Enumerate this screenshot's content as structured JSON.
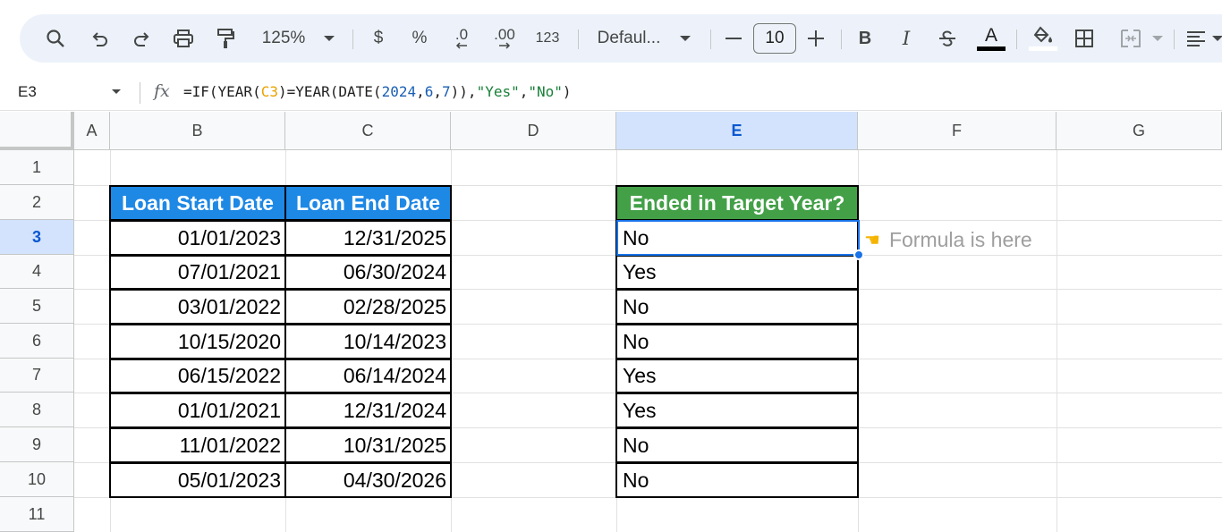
{
  "toolbar": {
    "zoom": "125%",
    "currency": "$",
    "percent": "%",
    "decrease_decimals": ".0",
    "increase_decimals": ".00",
    "number_format": "123",
    "font_family": "Defaul...",
    "font_size": "10",
    "bold": "B",
    "italic": "I",
    "text_color": "A"
  },
  "formula_bar": {
    "name_box": "E3",
    "fx": "fx",
    "formula_parts": {
      "p1": "=IF(YEAR(",
      "ref": "C3",
      "p2": ")=YEAR(DATE(",
      "n1": "2024",
      "c1": ",",
      "n2": "6",
      "c2": ",",
      "n3": "7",
      "p3": ")),",
      "s1": "\"Yes\"",
      "c3": ",",
      "s2": "\"No\"",
      "p4": ")"
    }
  },
  "columns": [
    "A",
    "B",
    "C",
    "D",
    "E",
    "F",
    "G"
  ],
  "rows": [
    "1",
    "2",
    "3",
    "4",
    "5",
    "6",
    "7",
    "8",
    "9",
    "10",
    "11"
  ],
  "table": {
    "header_start": "Loan Start Date",
    "header_end": "Loan End Date",
    "header_result": "Ended in Target Year?",
    "start_dates": [
      "01/01/2023",
      "07/01/2021",
      "03/01/2022",
      "10/15/2020",
      "06/15/2022",
      "01/01/2021",
      "11/01/2022",
      "05/01/2023"
    ],
    "end_dates": [
      "12/31/2025",
      "06/30/2024",
      "02/28/2025",
      "10/14/2023",
      "06/14/2024",
      "12/31/2024",
      "10/31/2025",
      "04/30/2026"
    ],
    "results": [
      "No",
      "Yes",
      "No",
      "No",
      "Yes",
      "Yes",
      "No",
      "No"
    ]
  },
  "note": {
    "hand": "☚",
    "text": "Formula is here"
  },
  "colors": {
    "header_blue": "#1e88e5",
    "header_green": "#43a047",
    "selection": "#1a73e8",
    "formula_ref": "#e8a200",
    "formula_number": "#1a5fb4",
    "formula_string": "#188038"
  },
  "icons": [
    "search-icon",
    "undo-icon",
    "redo-icon",
    "print-icon",
    "paint-format-icon",
    "fill-color-icon",
    "borders-icon",
    "merge-cells-icon",
    "align-icon",
    "strikethrough-icon"
  ]
}
